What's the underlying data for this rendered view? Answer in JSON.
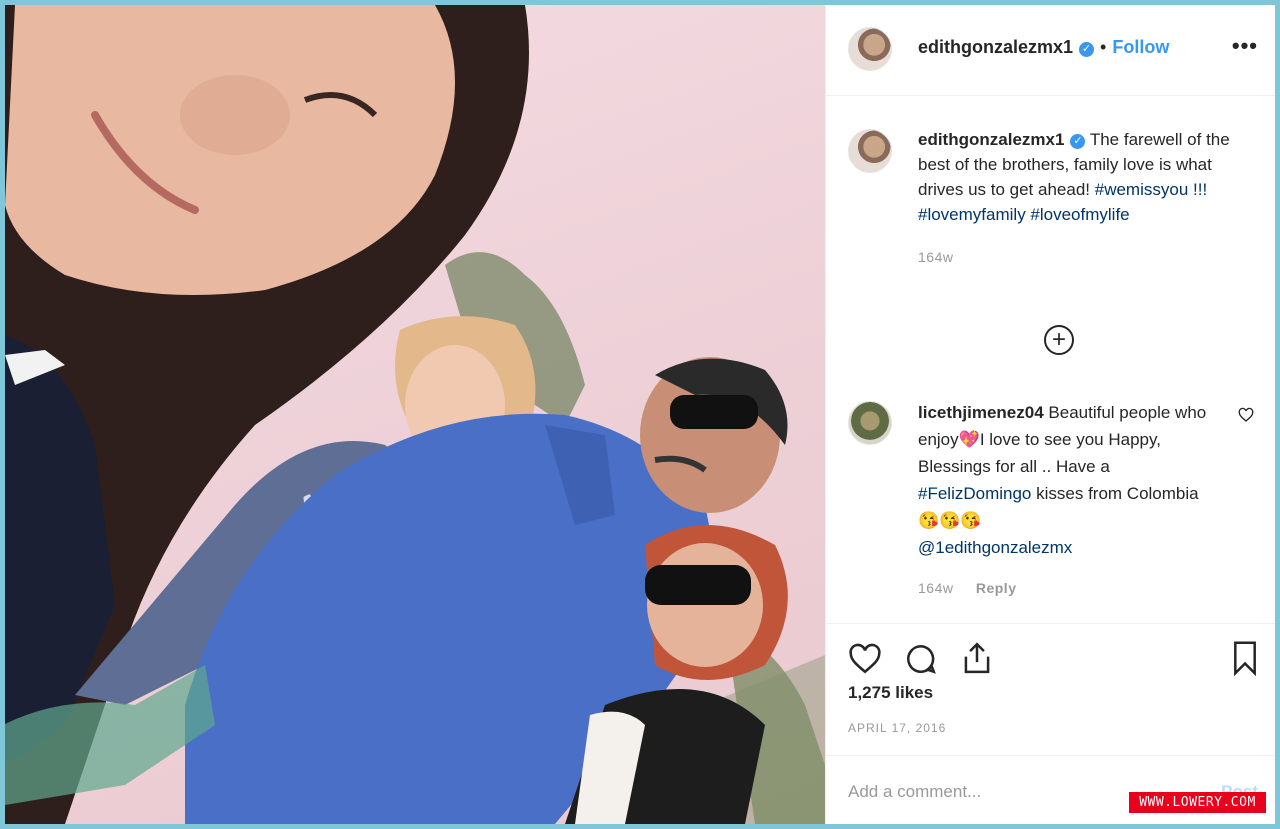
{
  "post": {
    "username": "edithgonzalezmx1",
    "separator": "•",
    "follow_label": "Follow",
    "more_label": "•••",
    "verified_icon": "verified-badge-icon",
    "caption": {
      "username": "edithgonzalezmx1",
      "text": "The farewell of the best of the brothers, family love is what drives us to get ahead!",
      "hashtags": "#wemissyou !!! #lovemyfamily #loveofmylife",
      "time": "164w"
    },
    "load_more_icon": "plus-circle-icon",
    "comment": {
      "username": "licethjimenez04",
      "text1": "Beautiful people who enjoy",
      "text2": "I love to see you Happy, Blessings for all .. Have a",
      "hashtag": "#FelizDomingo",
      "text3": "kisses from Colombia",
      "mention": "@1edithgonzalezmx",
      "time": "164w",
      "reply_label": "Reply"
    },
    "likes": "1,275 likes",
    "date": "APRIL 17, 2016",
    "add_comment_placeholder": "Add a comment...",
    "post_label": "Post"
  },
  "watermark": "WWW.LOWERY.COM",
  "colors": {
    "accent": "#3897f0",
    "frame": "#7fc6d8",
    "hashtag": "#003569"
  }
}
